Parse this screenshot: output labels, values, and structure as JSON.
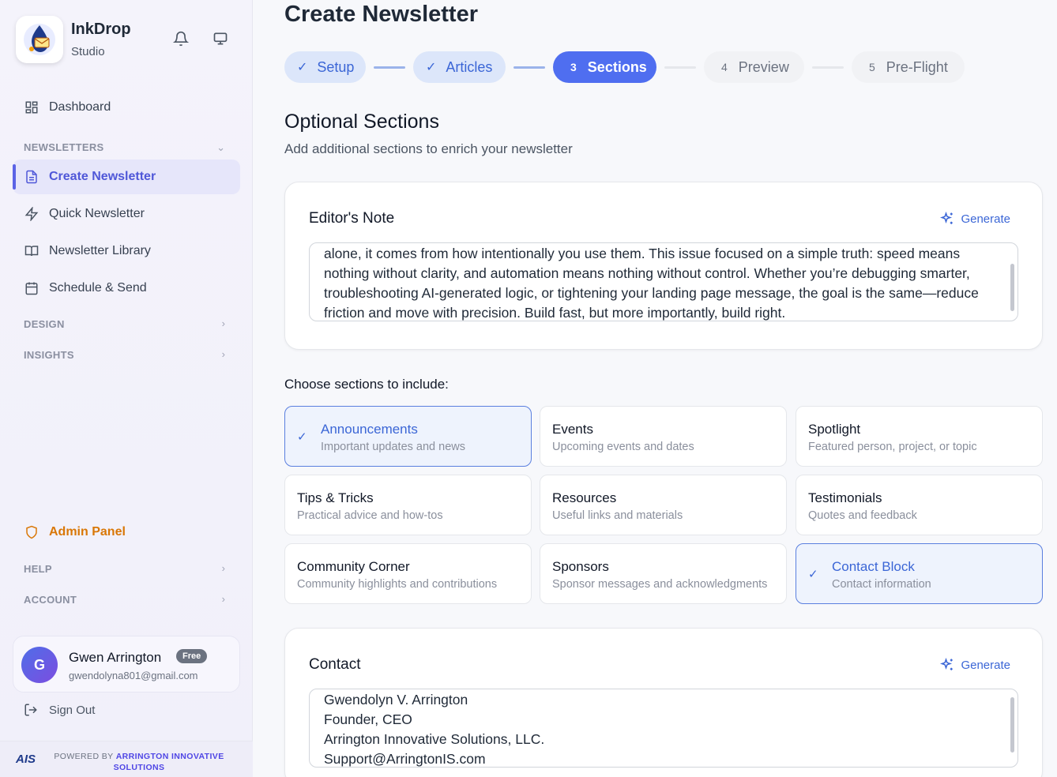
{
  "app": {
    "name": "InkDrop",
    "subtitle": "Studio"
  },
  "sidebar": {
    "dashboard": "Dashboard",
    "newsletters_label": "NEWSLETTERS",
    "items": [
      {
        "label": "Create Newsletter"
      },
      {
        "label": "Quick Newsletter"
      },
      {
        "label": "Newsletter Library"
      },
      {
        "label": "Schedule & Send"
      }
    ],
    "design_label": "DESIGN",
    "insights_label": "INSIGHTS",
    "admin_label": "Admin Panel",
    "help_label": "HELP",
    "account_label": "ACCOUNT"
  },
  "user": {
    "initial": "G",
    "name": "Gwen Arrington",
    "plan": "Free",
    "email": "gwendolyna801@gmail.com"
  },
  "signout": "Sign Out",
  "footer": {
    "logo": "AIS",
    "prefix": "POWERED BY ",
    "company": "ARRINGTON INNOVATIVE SOLUTIONS"
  },
  "page": {
    "title": "Create Newsletter",
    "steps": [
      {
        "num": "",
        "label": "Setup",
        "state": "done"
      },
      {
        "num": "",
        "label": "Articles",
        "state": "done"
      },
      {
        "num": "3",
        "label": "Sections",
        "state": "current"
      },
      {
        "num": "4",
        "label": "Preview",
        "state": "todo"
      },
      {
        "num": "5",
        "label": "Pre-Flight",
        "state": "todo"
      }
    ],
    "heading": "Optional Sections",
    "subheading": "Add additional sections to enrich your newsletter"
  },
  "editors_note": {
    "title": "Editor's Note",
    "generate_label": "Generate",
    "text": "alone, it comes from how intentionally you use them. This issue focused on a simple truth: speed means nothing without clarity, and automation means nothing without control. Whether you’re debugging smarter, troubleshooting AI-generated logic, or tightening your landing page message, the goal is the same—reduce friction and move with precision. Build fast, but more importantly, build right."
  },
  "choose_label": "Choose sections to include:",
  "sections": [
    {
      "title": "Announcements",
      "desc": "Important updates and news",
      "selected": true
    },
    {
      "title": "Events",
      "desc": "Upcoming events and dates",
      "selected": false
    },
    {
      "title": "Spotlight",
      "desc": "Featured person, project, or topic",
      "selected": false
    },
    {
      "title": "Tips & Tricks",
      "desc": "Practical advice and how-tos",
      "selected": false
    },
    {
      "title": "Resources",
      "desc": "Useful links and materials",
      "selected": false
    },
    {
      "title": "Testimonials",
      "desc": "Quotes and feedback",
      "selected": false
    },
    {
      "title": "Community Corner",
      "desc": "Community highlights and contributions",
      "selected": false
    },
    {
      "title": "Sponsors",
      "desc": "Sponsor messages and acknowledgments",
      "selected": false
    },
    {
      "title": "Contact Block",
      "desc": "Contact information",
      "selected": true
    }
  ],
  "contact": {
    "title": "Contact",
    "generate_label": "Generate",
    "text": "Gwendolyn V. Arrington\nFounder, CEO\nArrington Innovative Solutions, LLC.\nSupport@ArringtonIS.com"
  },
  "colors": {
    "accent": "#4f6ef0",
    "admin": "#d97706",
    "selected_border": "#5a7fdf"
  },
  "icons": [
    "logo-icon",
    "bell-icon",
    "monitor-icon",
    "dashboard-icon",
    "document-icon",
    "bolt-icon",
    "book-icon",
    "calendar-icon",
    "shield-icon",
    "signout-icon",
    "sparkle-icon",
    "check-icon",
    "chevron-down-icon",
    "chevron-right-icon"
  ]
}
